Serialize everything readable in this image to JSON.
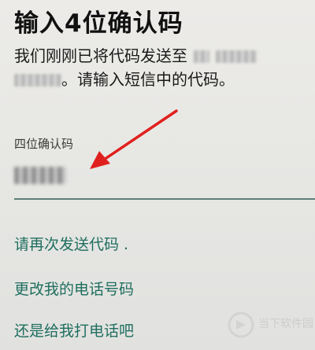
{
  "screen": {
    "title": "输入4位确认码",
    "description_part1": "我们刚刚已将代码发送至",
    "description_part2": "。请输入短信中的代码。",
    "field_label": "四位确认码",
    "links": {
      "resend": "请再次发送代码 .",
      "change_number": "更改我的电话号码",
      "call_me": "还是给我打电话吧"
    },
    "watermark_text": "当下软件园"
  },
  "colors": {
    "link": "#1f6e5f",
    "arrow": "#e0201e",
    "underline": "#5d7f76"
  },
  "icons": {
    "annotation": "red-arrow-icon",
    "watermark": "logo-icon"
  }
}
